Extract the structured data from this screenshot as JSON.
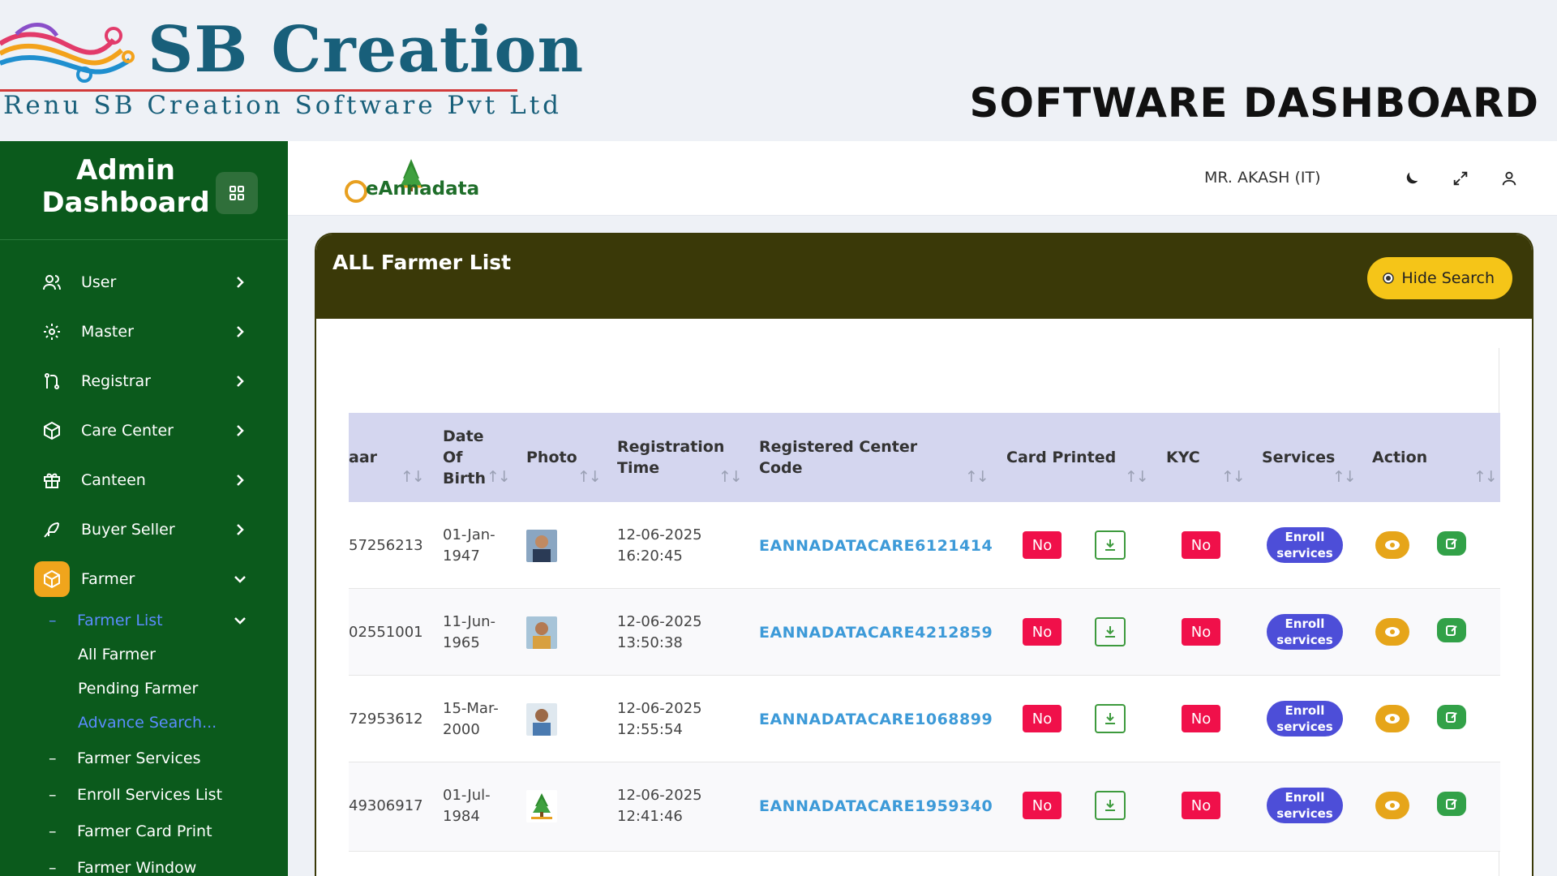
{
  "banner": {
    "brand_name": "SB Creation",
    "brand_tagline": "Renu SB Creation Software Pvt Ltd",
    "title": "SOFTWARE DASHBOARD"
  },
  "sidebar": {
    "title_line1": "Admin",
    "title_line2": "Dashboard",
    "items": [
      {
        "label": "User",
        "icon": "users-icon"
      },
      {
        "label": "Master",
        "icon": "gear-icon"
      },
      {
        "label": "Registrar",
        "icon": "git-branch-icon"
      },
      {
        "label": "Care Center",
        "icon": "box-icon"
      },
      {
        "label": "Canteen",
        "icon": "gift-icon"
      },
      {
        "label": "Buyer Seller",
        "icon": "feather-icon"
      },
      {
        "label": "Farmer",
        "icon": "package-icon"
      }
    ],
    "farmer_submenu": {
      "farmer_list": "Farmer List",
      "farmer_list_children": [
        "All Farmer",
        "Pending Farmer",
        "Advance Search..."
      ],
      "others": [
        "Farmer Services",
        "Enroll Services List",
        "Farmer Card Print",
        "Farmer Window"
      ]
    }
  },
  "topbar": {
    "app_name": "eAnnadata",
    "user": "MR. AKASH (IT)"
  },
  "card": {
    "title": "ALL Farmer List",
    "hide_search": "Hide Search"
  },
  "table": {
    "columns": {
      "aadhaar": "aar",
      "dob_1": "Date",
      "dob_2": "Of",
      "dob_3": "Birth",
      "photo": "Photo",
      "reg_time_1": "Registration",
      "reg_time_2": "Time",
      "center_code": "Registered Center Code",
      "card_printed": "Card Printed",
      "kyc": "KYC",
      "services": "Services",
      "action": "Action"
    },
    "sort_glyph": "↑↓",
    "rows": [
      {
        "aadhaar": "57256213",
        "dob_1": "01-Jan-",
        "dob_2": "1947",
        "reg_date": "12-06-2025",
        "reg_time": "16:20:45",
        "center_code": "EANNADATACARE6121414",
        "card_printed": "No",
        "kyc": "No",
        "service_1": "Enroll",
        "service_2": "services"
      },
      {
        "aadhaar": "02551001",
        "dob_1": "11-Jun-",
        "dob_2": "1965",
        "reg_date": "12-06-2025",
        "reg_time": "13:50:38",
        "center_code": "EANNADATACARE4212859",
        "card_printed": "No",
        "kyc": "No",
        "service_1": "Enroll",
        "service_2": "services"
      },
      {
        "aadhaar": "72953612",
        "dob_1": "15-Mar-",
        "dob_2": "2000",
        "reg_date": "12-06-2025",
        "reg_time": "12:55:54",
        "center_code": "EANNADATACARE1068899",
        "card_printed": "No",
        "kyc": "No",
        "service_1": "Enroll",
        "service_2": "services"
      },
      {
        "aadhaar": "49306917",
        "dob_1": "01-Jul-",
        "dob_2": "1984",
        "reg_date": "12-06-2025",
        "reg_time": "12:41:46",
        "center_code": "EANNADATACARE1959340",
        "card_printed": "No",
        "kyc": "No",
        "service_1": "Enroll",
        "service_2": "services"
      }
    ]
  },
  "colors": {
    "sidebar_bg": "#0b5a1c",
    "card_header": "#3a3908",
    "accent_yellow": "#f5c518",
    "badge_red": "#f0104a",
    "enroll_blue": "#4d4ed8",
    "code_blue": "#3d9ad8"
  }
}
